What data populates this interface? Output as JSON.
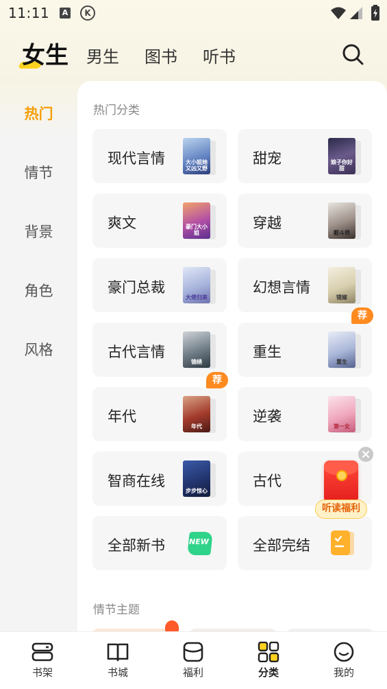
{
  "status_bar": {
    "time": "11:11",
    "icons": [
      "a-icon",
      "k-icon",
      "wifi-icon",
      "signal-icon",
      "battery-icon"
    ],
    "icon_a": "A",
    "icon_k": "K"
  },
  "top_tabs": [
    {
      "label": "女生",
      "active": true
    },
    {
      "label": "男生",
      "active": false
    },
    {
      "label": "图书",
      "active": false
    },
    {
      "label": "听书",
      "active": false
    }
  ],
  "sidebar": {
    "items": [
      {
        "label": "热门",
        "active": true
      },
      {
        "label": "情节",
        "active": false
      },
      {
        "label": "背景",
        "active": false
      },
      {
        "label": "角色",
        "active": false
      },
      {
        "label": "风格",
        "active": false
      }
    ]
  },
  "hot_section": {
    "title": "热门分类",
    "categories": [
      {
        "label": "现代言情",
        "cover_text": "大小姐她又凶又野",
        "badge": ""
      },
      {
        "label": "甜宠",
        "cover_text": "娘子你好甜",
        "badge": ""
      },
      {
        "label": "爽文",
        "cover_text": "豪门大小姐",
        "badge": ""
      },
      {
        "label": "穿越",
        "cover_text": "睚斗师",
        "badge": ""
      },
      {
        "label": "豪门总裁",
        "cover_text": "大佬归来",
        "badge": ""
      },
      {
        "label": "幻想言情",
        "cover_text": "错嫁",
        "badge": ""
      },
      {
        "label": "古代言情",
        "cover_text": "锦绣",
        "badge": ""
      },
      {
        "label": "重生",
        "cover_text": "重生",
        "badge": "荐"
      },
      {
        "label": "年代",
        "cover_text": "年代",
        "badge": "荐"
      },
      {
        "label": "逆袭",
        "cover_text": "第一女",
        "badge": ""
      },
      {
        "label": "智商在线",
        "cover_text": "步步惊心",
        "badge": ""
      },
      {
        "label": "古代",
        "cover_text": "",
        "badge": ""
      },
      {
        "label": "全部新书",
        "cover_text": "NEW",
        "badge": ""
      },
      {
        "label": "全部完结",
        "cover_text": "",
        "badge": ""
      }
    ]
  },
  "floating_reward": {
    "label": "听读福利"
  },
  "plot_section": {
    "title": "情节主题"
  },
  "bottom_nav": [
    {
      "label": "书架",
      "icon": "bookshelf-icon",
      "active": false
    },
    {
      "label": "书城",
      "icon": "book-store-icon",
      "active": false
    },
    {
      "label": "福利",
      "icon": "welfare-icon",
      "active": false
    },
    {
      "label": "分类",
      "icon": "category-icon",
      "active": true
    },
    {
      "label": "我的",
      "icon": "profile-icon",
      "active": false
    }
  ],
  "colors": {
    "accent": "#f59f0b",
    "tab_underline": "#ffd21f",
    "badge": "#ff8a1f",
    "envelope": "#e41d1d"
  }
}
